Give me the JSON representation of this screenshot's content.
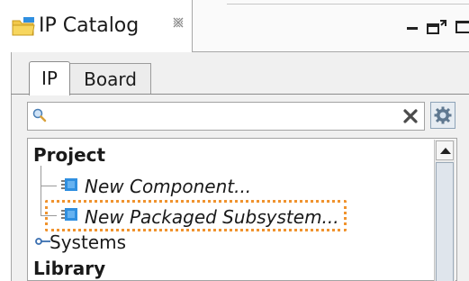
{
  "view_tab": {
    "title": "IP Catalog",
    "icons": [
      "folder-icon",
      "close-icon"
    ]
  },
  "window_controls": {
    "icons": [
      "minimize-icon",
      "restore-icon",
      "maximize-icon"
    ]
  },
  "subtabs": {
    "ip": "IP",
    "board": "Board"
  },
  "search": {
    "value": "",
    "icons": [
      "search-icon",
      "clear-icon",
      "settings-icon"
    ]
  },
  "tree": {
    "project": "Project",
    "items": [
      {
        "label": "New Component...",
        "icon": "ip-block-icon"
      },
      {
        "label": "New Packaged Subsystem...",
        "icon": "ip-block-icon"
      }
    ],
    "systems": "Systems",
    "library": "Library"
  },
  "colors": {
    "highlight": "#f0932e",
    "ip_icon_blue": "#2f8fe0",
    "folder_yellow": "#f2c84a"
  }
}
